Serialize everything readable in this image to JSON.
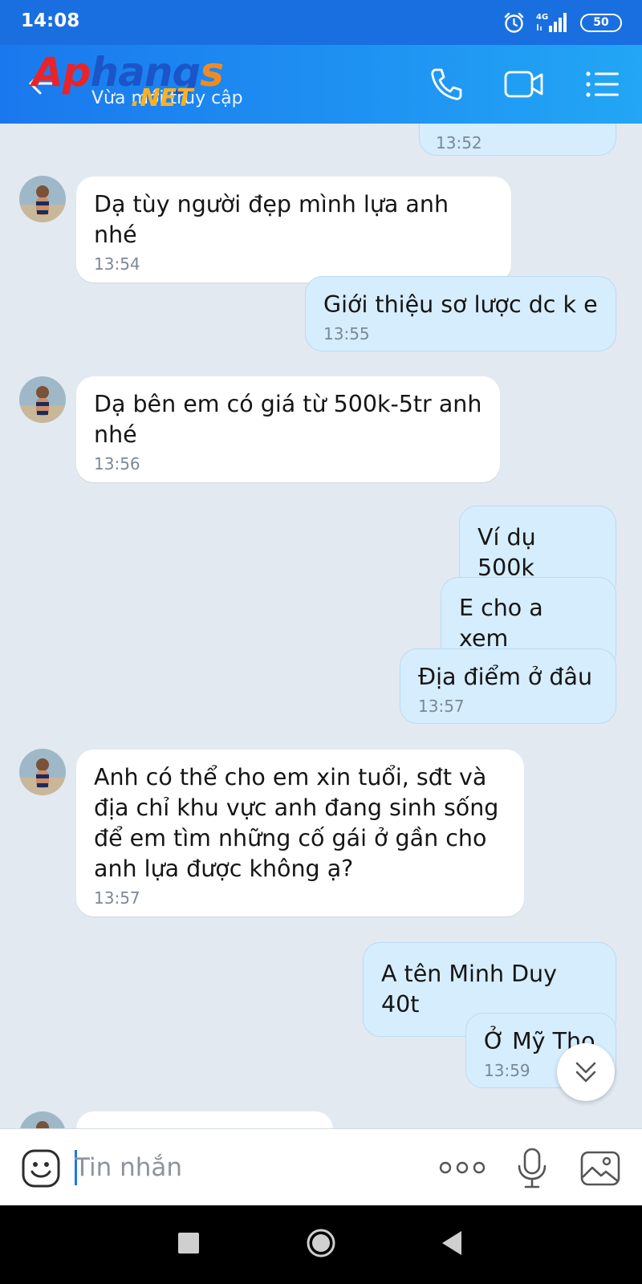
{
  "status_bar": {
    "time": "14:08",
    "network": "4G",
    "battery": "50"
  },
  "header": {
    "logo": {
      "part1": "Ap",
      "part2": "hang",
      "part3": "s",
      "suffix": ".NET"
    },
    "subtitle": "Vừa mới truy cập",
    "icons": [
      "back-icon",
      "phone-icon",
      "video-icon",
      "menu-icon"
    ]
  },
  "messages": [
    {
      "direction": "out",
      "text": "",
      "time": "13:52"
    },
    {
      "direction": "in",
      "text": "Dạ tùy người đẹp mình lựa anh nhé",
      "time": "13:54"
    },
    {
      "direction": "out",
      "text": "Giới thiệu sơ lược dc k e",
      "time": "13:55"
    },
    {
      "direction": "in",
      "text": "Dạ bên em có giá từ 500k-5tr anh nhé",
      "time": "13:56"
    },
    {
      "direction": "out",
      "text": "Ví dụ 500k",
      "time": ""
    },
    {
      "direction": "out",
      "text": "E cho a xem",
      "time": ""
    },
    {
      "direction": "out",
      "text": "Địa điểm ở đâu",
      "time": "13:57"
    },
    {
      "direction": "in",
      "text": "Anh có thể cho em xin tuổi, sđt và địa chỉ khu vực anh đang sinh sống để em tìm những cố gái ở gần cho anh lựa được không ạ?",
      "time": "13:57"
    },
    {
      "direction": "out",
      "text": "A tên Minh Duy 40t",
      "time": ""
    },
    {
      "direction": "out",
      "text": "Ở Mỹ Tho",
      "time": "13:59"
    },
    {
      "direction": "in",
      "text": "",
      "time": ""
    }
  ],
  "composer": {
    "placeholder": "Tin nhắn",
    "icons": [
      "emoji-icon",
      "more-icon",
      "mic-icon",
      "image-icon"
    ]
  },
  "colors": {
    "header_start": "#1a78ee",
    "header_end": "#22a6f5",
    "chat_bg": "#e2e9f1",
    "incoming_bubble": "#ffffff",
    "outgoing_bubble": "#d6edfd"
  }
}
